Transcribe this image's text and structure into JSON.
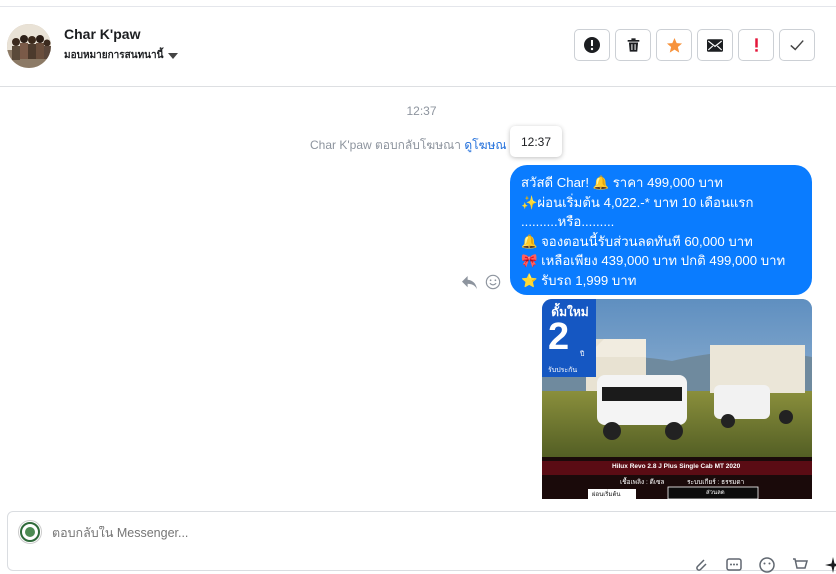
{
  "header": {
    "contact_name": "Char K'paw",
    "assign_label": "มอบหมายการสนทนานี้",
    "actions": [
      {
        "name": "spam-report-button",
        "icon": "alert-circle-icon"
      },
      {
        "name": "delete-button",
        "icon": "trash-icon"
      },
      {
        "name": "star-button",
        "icon": "star-icon"
      },
      {
        "name": "mark-unread-button",
        "icon": "envelope-icon"
      },
      {
        "name": "follow-up-button",
        "icon": "exclamation-icon"
      },
      {
        "name": "mark-done-button",
        "icon": "checkmark-icon"
      }
    ]
  },
  "thread": {
    "timestamp": "12:37",
    "reply_note_prefix": "Char K'paw ตอบกลับโฆษณา",
    "reply_note_link": "ดูโฆษณ",
    "tooltip_time": "12:37",
    "message_lines": [
      "สวัสดี Char! 🔔  ราคา 499,000 บาท",
      "✨ผ่อนเริ่มต้น 4,022.-* บาท 10 เดือนแรก",
      "..........หรือ.........",
      "🔔 จองตอนนี้รับส่วนลดทันที 60,000 บาท",
      "🎀 เหลือเพียง 439,000 บาท ปกติ 499,000 บาท",
      "⭐ รับรถ 1,999 บาท"
    ],
    "ad_image": {
      "badge_top": "ดั้มใหม่",
      "badge_number": "2",
      "badge_unit": "ปี",
      "badge_bottom": "รับประกัน",
      "model_text": "Hilux Revo 2.8 J Plus Single Cab MT 2020",
      "spec_fuel_label": "เชื้อเพลิง :",
      "spec_fuel_value": "ดีเซล",
      "spec_gear_label": "ระบบเกียร์ :",
      "spec_gear_value": "ธรรมดา",
      "promo_left": "ผ่อนเริ่มต้น",
      "promo_right": "ส่วนลด"
    }
  },
  "composer": {
    "placeholder": "ตอบกลับใน Messenger..."
  },
  "colors": {
    "bubble": "#0a7cff",
    "link": "#216fdb",
    "star": "#f7923b",
    "alert": "#e4163a"
  }
}
